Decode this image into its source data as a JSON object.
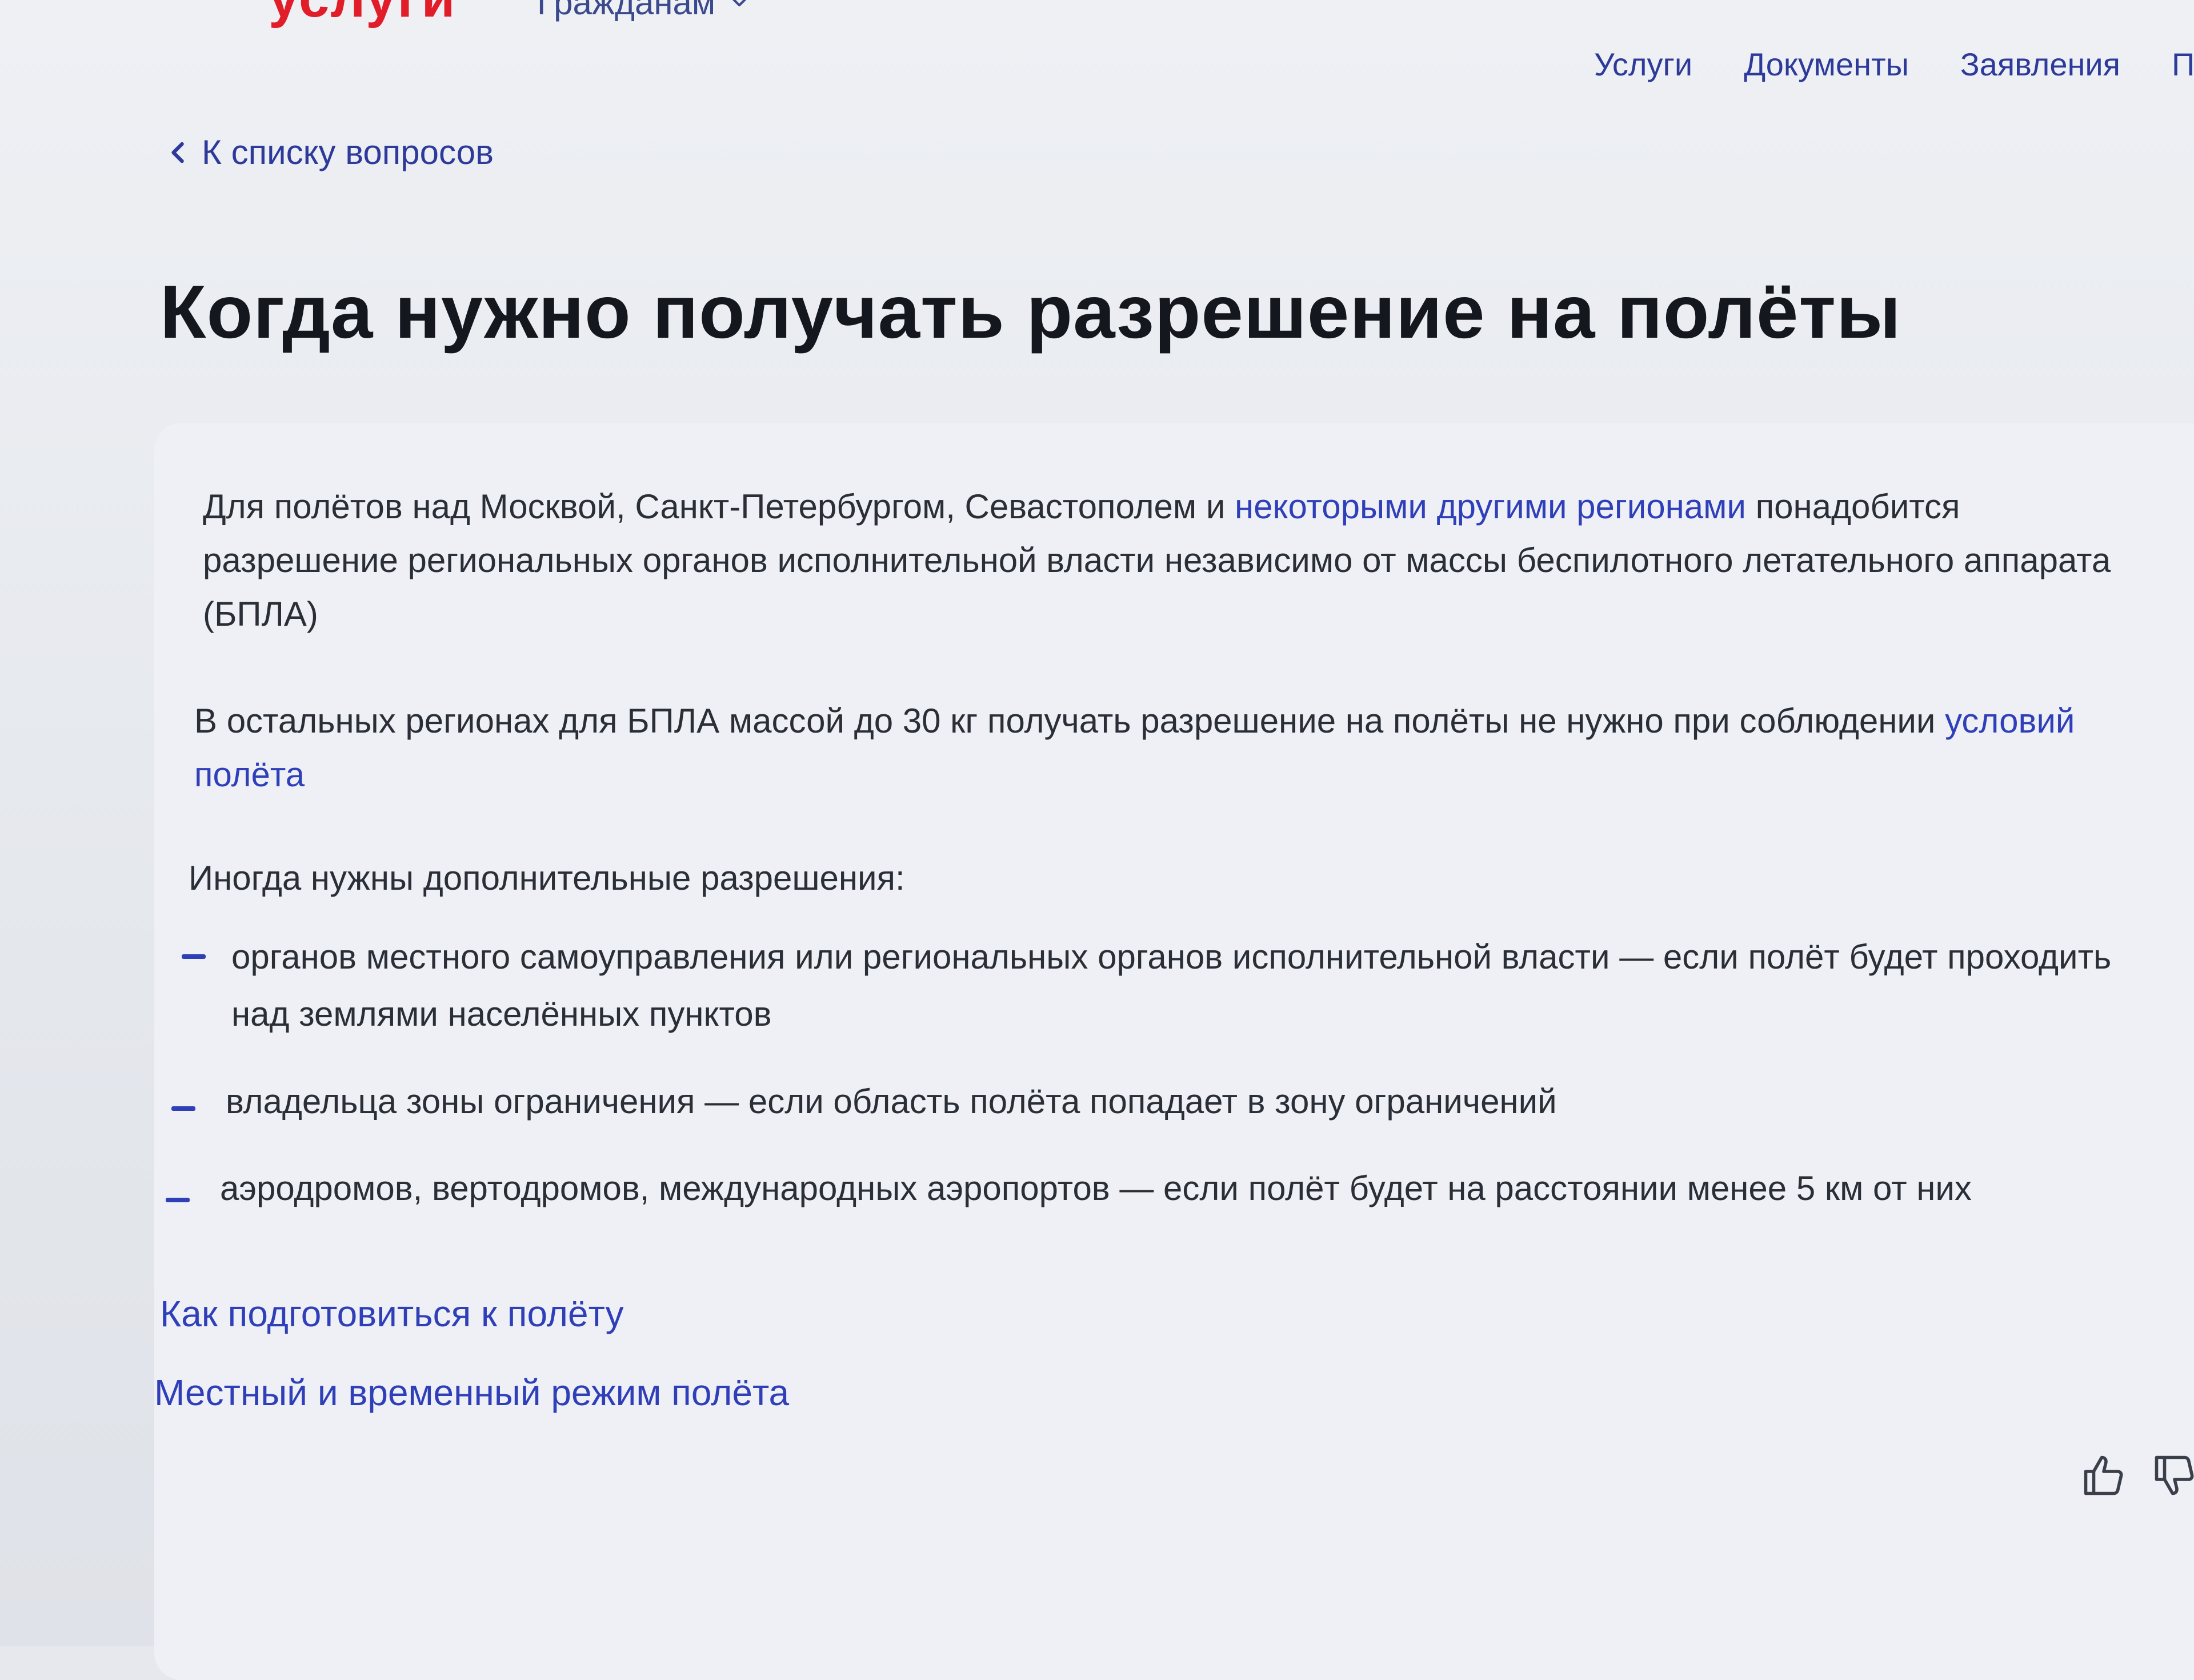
{
  "header": {
    "logo": "услуги",
    "audience": "Гражданам",
    "nav": [
      "Услуги",
      "Документы",
      "Заявления",
      "П"
    ]
  },
  "back_link": "К списку вопросов",
  "title": "Когда нужно получать разрешение на полёты",
  "content": {
    "p1": {
      "before": "Для полётов над Москвой, Санкт-Петербургом, Севастополем и ",
      "link": "некоторыми другими регионами",
      "after": " понадобится разрешение региональных органов исполнительной власти независимо от массы беспилотного летательного аппарата (БПЛА)"
    },
    "p2": {
      "before": "В остальных регионах для БПЛА массой до 30 кг получать разрешение на полёты не нужно при соблюдении ",
      "link": "условий полёта"
    },
    "p3": "Иногда нужны дополнительные разрешения:",
    "bullets": [
      "органов местного самоуправления или региональных органов исполнительной власти — если полёт будет проходить над землями населённых пунктов",
      "владельца зоны ограничения — если область полёта попадает в зону ограничений",
      "аэродромов, вертодромов, международных аэропортов — если полёт будет на расстоянии менее 5 км от них"
    ]
  },
  "related": [
    "Как подготовиться к полёту",
    "Местный и временный режим полёта"
  ],
  "feedback": {
    "icons": [
      "thumbs-up-icon",
      "thumbs-down-icon"
    ]
  },
  "colors": {
    "accent": "#2f3fb8",
    "logo": "#e11d2a",
    "title": "#14171d"
  }
}
